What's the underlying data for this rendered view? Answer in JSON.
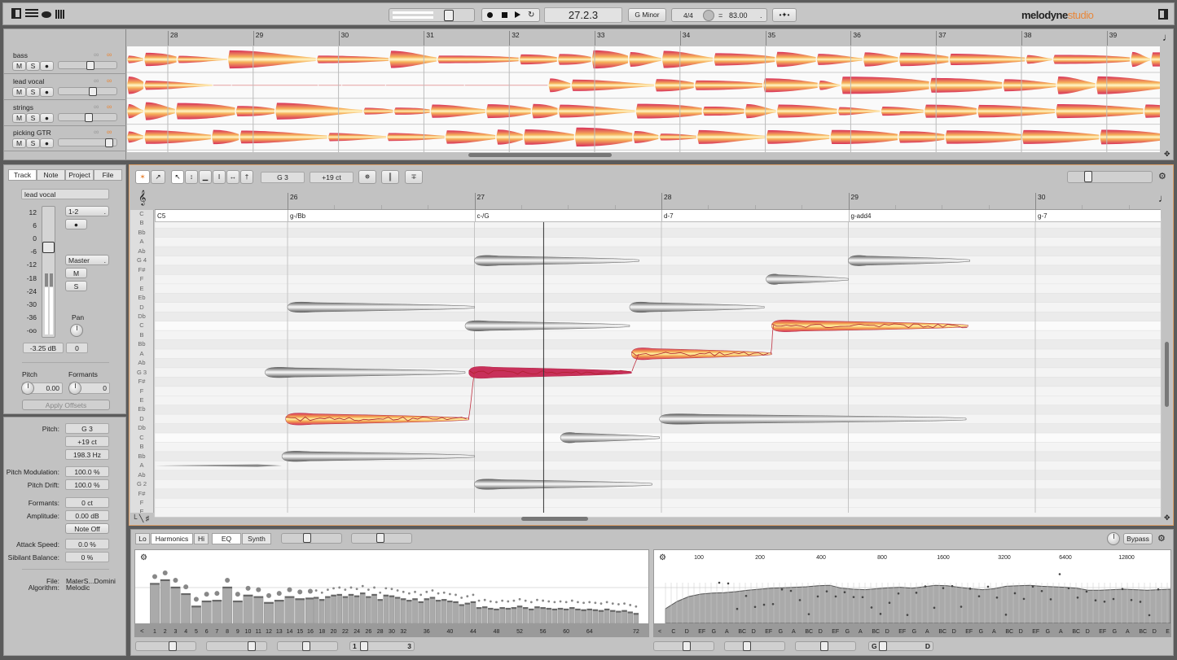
{
  "toolbar": {
    "position": "27.2.3",
    "key": "G Minor",
    "time_signature": "4/4",
    "tempo_prefix": "=",
    "tempo": "83.00",
    "logo_main": "melodyne",
    "logo_sub": "studio",
    "accent_color": "#e8873a"
  },
  "overview": {
    "bars": [
      "28",
      "29",
      "30",
      "31",
      "32",
      "33",
      "34",
      "35",
      "36",
      "37",
      "38",
      "39"
    ],
    "tracks": [
      {
        "name": "bass",
        "mute": "M",
        "solo": "S",
        "volume": 0.55
      },
      {
        "name": "lead vocal",
        "mute": "M",
        "solo": "S",
        "volume": 0.6
      },
      {
        "name": "strings",
        "mute": "M",
        "solo": "S",
        "volume": 0.52
      },
      {
        "name": "picking GTR",
        "mute": "M",
        "solo": "S",
        "volume": 0.92
      }
    ]
  },
  "inspector": {
    "tabs": [
      "Track",
      "Note",
      "Project",
      "File"
    ],
    "active_tab": "Track",
    "track_name": "lead vocal",
    "fader_scale": [
      "12",
      "6",
      "0",
      "-6",
      "-12",
      "-18",
      "-24",
      "-30",
      "-36",
      "-oo"
    ],
    "input": "1-2",
    "output": "Master",
    "mute": "M",
    "solo": "S",
    "pan_label": "Pan",
    "volume": "-3.25 dB",
    "pan": "0",
    "pitch_label": "Pitch",
    "pitch_value": "0.00",
    "formants_label": "Formants",
    "formants_value": "0",
    "apply_offsets": "Apply Offsets"
  },
  "note_inspector": {
    "pitch_label": "Pitch:",
    "pitch": "G 3",
    "cents": "+19 ct",
    "frequency": "198.3 Hz",
    "pitch_mod_label": "Pitch Modulation:",
    "pitch_mod": "100.0 %",
    "pitch_drift_label": "Pitch Drift:",
    "pitch_drift": "100.0 %",
    "formants_label": "Formants:",
    "formants": "0 ct",
    "amplitude_label": "Amplitude:",
    "amplitude": "0.00 dB",
    "note_off": "Note Off",
    "attack_label": "Attack Speed:",
    "attack": "0.0 %",
    "sibilant_label": "Sibilant Balance:",
    "sibilant": "0 %",
    "file_label": "File:",
    "file": "MaterS...Domini",
    "algorithm_label": "Algorithm:",
    "algorithm": "Melodic"
  },
  "editor": {
    "pitch_field": "G 3",
    "cents_field": "+19 ct",
    "bars": [
      "26",
      "27",
      "28",
      "29",
      "30"
    ],
    "chords": [
      {
        "label": "C5",
        "bar": 25.29
      },
      {
        "label": "g-/Bb",
        "bar": 26
      },
      {
        "label": "c-/G",
        "bar": 27
      },
      {
        "label": "d-7",
        "bar": 28
      },
      {
        "label": "g-add4",
        "bar": 29
      },
      {
        "label": "g-7",
        "bar": 30
      }
    ],
    "keys": [
      "C",
      "B",
      "Bb",
      "A",
      "Ab",
      "G 4",
      "F#",
      "F",
      "E",
      "Eb",
      "D",
      "Db",
      "C",
      "B",
      "Bb",
      "A",
      "Ab",
      "G 3",
      "F#",
      "F",
      "E",
      "Eb",
      "D",
      "Db",
      "C",
      "B",
      "Bb",
      "A",
      "Ab",
      "G 2",
      "F#",
      "F",
      "E"
    ],
    "playhead_bar": 27.37,
    "notes": [
      {
        "pitch": "A 2",
        "start": 25.29,
        "end": 25.97,
        "style": "thin"
      },
      {
        "pitch": "Bb 2",
        "start": 25.97,
        "end": 27.0,
        "style": "gray"
      },
      {
        "pitch": "D 3",
        "start": 25.99,
        "end": 26.97,
        "style": "orange"
      },
      {
        "pitch": "G 3",
        "start": 25.88,
        "end": 26.95,
        "style": "gray"
      },
      {
        "pitch": "D 4",
        "start": 26.0,
        "end": 27.0,
        "style": "gray"
      },
      {
        "pitch": "G 3",
        "start": 26.97,
        "end": 27.84,
        "style": "selected"
      },
      {
        "pitch": "G 4",
        "start": 27.0,
        "end": 27.88,
        "style": "gray"
      },
      {
        "pitch": "C 4",
        "start": 26.95,
        "end": 27.83,
        "style": "gray"
      },
      {
        "pitch": "G 2",
        "start": 27.0,
        "end": 27.95,
        "style": "gray"
      },
      {
        "pitch": "C 3",
        "start": 27.46,
        "end": 27.99,
        "style": "gray"
      },
      {
        "pitch": "A 3",
        "start": 27.84,
        "end": 28.59,
        "style": "orange"
      },
      {
        "pitch": "D 4",
        "start": 27.83,
        "end": 28.55,
        "style": "gray"
      },
      {
        "pitch": "D 3",
        "start": 27.99,
        "end": 29.63,
        "style": "gray"
      },
      {
        "pitch": "F 4",
        "start": 28.56,
        "end": 29.0,
        "style": "gray"
      },
      {
        "pitch": "C 4",
        "start": 28.59,
        "end": 29.64,
        "style": "orange"
      },
      {
        "pitch": "G 4",
        "start": 29.0,
        "end": 29.65,
        "style": "gray"
      }
    ],
    "note_colors": {
      "gray": "#8a8a8a",
      "orange_edge": "#d8345a",
      "orange_core": "#fff2a0",
      "selected": "#c8305a"
    }
  },
  "sound_editor": {
    "tabs": [
      "Lo",
      "Harmonics",
      "Hi",
      "EQ",
      "Synth"
    ],
    "bypass": "Bypass",
    "harmonic_labels": [
      "1",
      "2",
      "3",
      "4",
      "5",
      "6",
      "7",
      "8",
      "9",
      "10",
      "11",
      "12",
      "13",
      "14",
      "15",
      "16",
      "18",
      "20",
      "22",
      "24",
      "26",
      "28",
      "30",
      "32",
      "36",
      "40",
      "44",
      "48",
      "52",
      "56",
      "60",
      "64",
      "72"
    ],
    "harmonic_levels": [
      0.55,
      0.6,
      0.5,
      0.41,
      0.24,
      0.31,
      0.32,
      0.5,
      0.31,
      0.39,
      0.37,
      0.29,
      0.32,
      0.37,
      0.34,
      0.35,
      0.36,
      0.33,
      0.37,
      0.39,
      0.4,
      0.37,
      0.4,
      0.38,
      0.42,
      0.37,
      0.4,
      0.33,
      0.39,
      0.38,
      0.36,
      0.34,
      0.32,
      0.34,
      0.3,
      0.34,
      0.36,
      0.32,
      0.33,
      0.31,
      0.3,
      0.26,
      0.28,
      0.3,
      0.22,
      0.23,
      0.21,
      0.2,
      0.22,
      0.21,
      0.22,
      0.24,
      0.22,
      0.2,
      0.23,
      0.22,
      0.21,
      0.2,
      0.21,
      0.2,
      0.22,
      0.2,
      0.19,
      0.2,
      0.19,
      0.18,
      0.2,
      0.18,
      0.17,
      0.18,
      0.16,
      0.14
    ],
    "freq_labels": [
      "100",
      "200",
      "400",
      "800",
      "1600",
      "3200",
      "6400",
      "12800"
    ],
    "note_letters": [
      "<",
      "C",
      "D",
      "EF",
      "G",
      "A",
      "BC",
      "D",
      "EF",
      "G",
      "A",
      "BC",
      "D",
      "EF",
      "G",
      "A",
      "BC",
      "D",
      "EF",
      "G",
      "A",
      "BC",
      "D",
      "EF",
      "G",
      "A",
      "BC",
      "D",
      "EF",
      "G",
      "A",
      "BC",
      "D",
      "EF",
      "G",
      "A",
      "BC",
      "D",
      "E"
    ],
    "eq_curve": [
      0.3,
      0.45,
      0.55,
      0.6,
      0.62,
      0.63,
      0.65,
      0.68,
      0.7,
      0.72,
      0.73,
      0.74,
      0.75,
      0.77,
      0.78,
      0.72,
      0.7,
      0.69,
      0.71,
      0.73,
      0.74,
      0.72,
      0.75,
      0.78,
      0.77,
      0.74,
      0.71,
      0.69,
      0.71,
      0.76,
      0.77,
      0.78,
      0.76,
      0.75,
      0.74,
      0.72,
      0.68,
      0.68,
      0.69,
      0.7,
      0.69,
      0.68,
      0.69,
      0.7
    ],
    "range_left_start": "1",
    "range_left_end": "3",
    "range_right_start": "G",
    "range_right_end": "D"
  }
}
